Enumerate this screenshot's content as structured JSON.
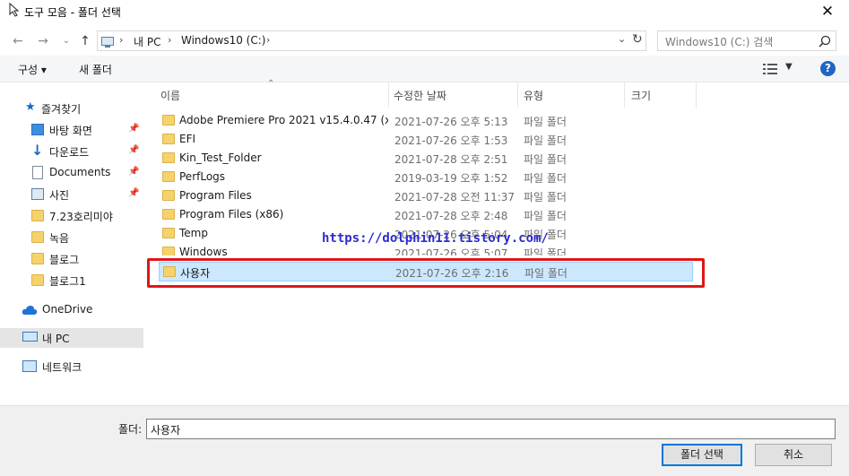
{
  "window": {
    "title": "도구 모음 - 폴더 선택"
  },
  "address": {
    "segments": [
      "내 PC",
      "Windows10 (C:)"
    ],
    "search_placeholder": "Windows10 (C:) 검색"
  },
  "commands": {
    "organize": "구성 ▾",
    "new_folder": "새 폴더"
  },
  "nav": {
    "quick_access": "즐겨찾기",
    "items": [
      {
        "label": "바탕 화면",
        "pinned": true
      },
      {
        "label": "다운로드",
        "pinned": true
      },
      {
        "label": "Documents",
        "pinned": true
      },
      {
        "label": "사진",
        "pinned": true
      },
      {
        "label": "7.23호리미야",
        "pinned": false
      },
      {
        "label": "녹음",
        "pinned": false
      },
      {
        "label": "블로그",
        "pinned": false
      },
      {
        "label": "블로그1",
        "pinned": false
      }
    ],
    "onedrive": "OneDrive",
    "this_pc": "내 PC",
    "network": "네트워크"
  },
  "columns": {
    "name": "이름",
    "modified": "수정한 날짜",
    "type": "유형",
    "size": "크기"
  },
  "files": [
    {
      "name": "Adobe Premiere Pro 2021 v15.4.0.47 (x...",
      "modified": "2021-07-26 오후 5:13",
      "type": "파일 폴더"
    },
    {
      "name": "EFI",
      "modified": "2021-07-26 오후 1:53",
      "type": "파일 폴더"
    },
    {
      "name": "Kin_Test_Folder",
      "modified": "2021-07-28 오후 2:51",
      "type": "파일 폴더"
    },
    {
      "name": "PerfLogs",
      "modified": "2019-03-19 오후 1:52",
      "type": "파일 폴더"
    },
    {
      "name": "Program Files",
      "modified": "2021-07-28 오전 11:37",
      "type": "파일 폴더"
    },
    {
      "name": "Program Files (x86)",
      "modified": "2021-07-28 오후 2:48",
      "type": "파일 폴더"
    },
    {
      "name": "Temp",
      "modified": "2021-07-26 오후 5:04",
      "type": "파일 폴더"
    },
    {
      "name": "Windows",
      "modified": "2021-07-26 오후 5:07",
      "type": "파일 폴더"
    },
    {
      "name": "사용자",
      "modified": "2021-07-26 오후 2:16",
      "type": "파일 폴더",
      "selected": true
    }
  ],
  "watermark": "https://dolphin11.tistory.com/",
  "footer": {
    "folder_label": "폴더:",
    "folder_value": "사용자",
    "select_button": "폴더 선택",
    "cancel_button": "취소"
  },
  "colors": {
    "accent": "#0078d7",
    "selection": "#cce8ff",
    "highlight_border": "#e01616",
    "watermark": "#2b2bd0"
  }
}
